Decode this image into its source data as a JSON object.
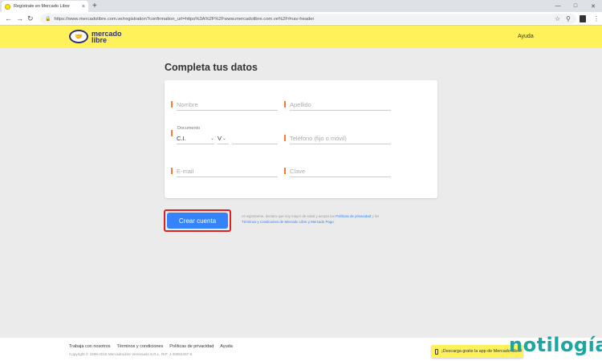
{
  "browser": {
    "tab_title": "Regístrate en Mercado Libre",
    "tab_close": "×",
    "new_tab": "+",
    "url": "https://www.mercadolibre.com.ve/registration?confirmation_url=https%3A%2F%2Fwww.mercadolibre.com.ve%2F#nav-header",
    "icons": [
      "back-icon",
      "forward-icon",
      "reload-icon",
      "lock-icon",
      "zoom-icon",
      "star-icon",
      "profile-icon",
      "menu-icon"
    ]
  },
  "header": {
    "logo_line1": "mercado",
    "logo_line2": "libre",
    "help": "Ayuda",
    "accent": "#fff159"
  },
  "main": {
    "title": "Completa tus datos",
    "fields": {
      "nombre": "Nombre",
      "apellido": "Apellido",
      "documento_label": "Documento",
      "doc_type": "C.I.",
      "doc_prefix": "V",
      "telefono": "Teléfono (fijo o móvil)",
      "email": "E-mail",
      "clave": "Clave"
    },
    "submit": "Crear cuenta",
    "legal": {
      "text1": "Al registrarme, declaro que soy mayor de edad y acepto las ",
      "link1": "Políticas de privacidad",
      "text2": " y los ",
      "link2": "Términos y condiciones de Mercado Libre y Mercado Pago",
      "text3": "."
    },
    "button_color": "#3483fa",
    "marker_color": "#ff7733"
  },
  "footer": {
    "links": [
      "Trabaja con nosotros",
      "Términos y condiciones",
      "Políticas de privacidad",
      "Ayuda"
    ],
    "copyright": "Copyright © 1999-2018 MercadoLibre Venezuela S.R.L. RIF: J-30684267-5.",
    "app_banner": "¡Descarga gratis la app de Mercado Libre!"
  },
  "watermark": "notilogía"
}
